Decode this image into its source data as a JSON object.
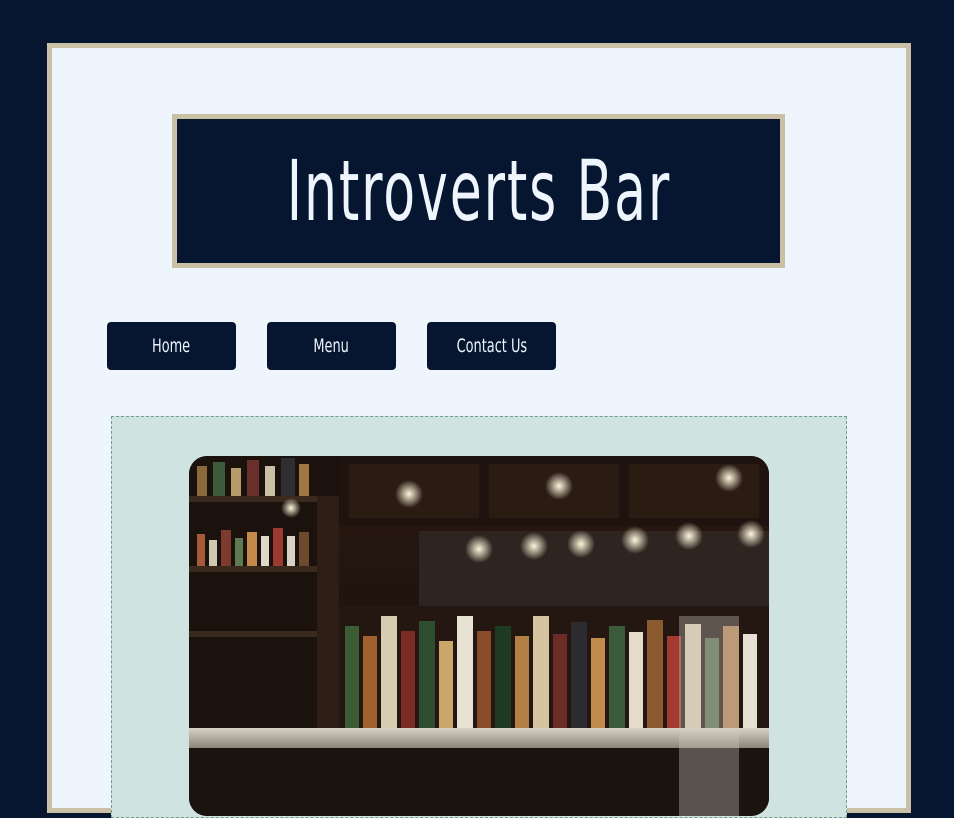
{
  "site": {
    "title": "Introverts Bar"
  },
  "nav": {
    "items": [
      {
        "label": "Home"
      },
      {
        "label": "Menu"
      },
      {
        "label": "Contact Us"
      }
    ]
  },
  "hero": {
    "image": "bar-shelves-with-liquor-bottles-photo"
  },
  "colors": {
    "background": "#061630",
    "page": "#eef5fc",
    "frame": "#c9c0a6",
    "panel": "#cfe3e0"
  }
}
